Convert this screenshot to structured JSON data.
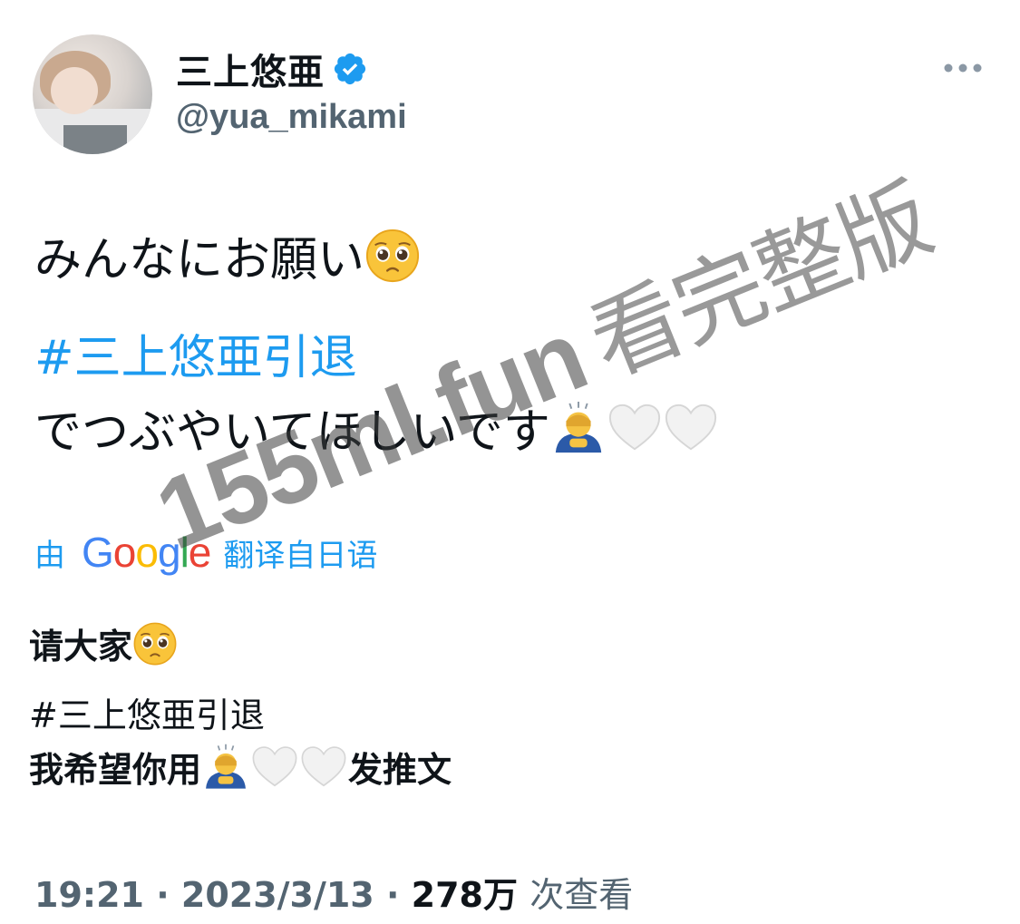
{
  "user": {
    "display_name": "三上悠亜",
    "handle": "@yua_mikami",
    "avatar_icon": "profile-photo",
    "verified_icon": "verified-badge-icon",
    "verified_color": "#1d9bf0"
  },
  "more_icon": "more-options-icon",
  "tweet": {
    "line1": "みんなにお願い",
    "line1_emoji": "pleading-face-emoji",
    "hashtag": "#三上悠亜引退",
    "line3": "でつぶやいてほしいです",
    "line3_emojis": [
      "person-bowing-emoji",
      "white-heart-emoji",
      "white-heart-emoji"
    ]
  },
  "translation": {
    "prefix": "由",
    "provider": "Google",
    "suffix": "翻译自日语",
    "line1": "请大家",
    "hashtag": "#三上悠亜引退",
    "line3_before": "我希望你用",
    "line3_after": "发推文"
  },
  "meta": {
    "time": "19:21",
    "separator": "·",
    "date": "2023/3/13",
    "views_count": "278万",
    "views_label": "次查看"
  },
  "watermark": {
    "text": "155ml.fun",
    "suffix": "看完整版"
  },
  "colors": {
    "link": "#1d9bf0",
    "text": "#0f1419",
    "secondary": "#536471"
  }
}
